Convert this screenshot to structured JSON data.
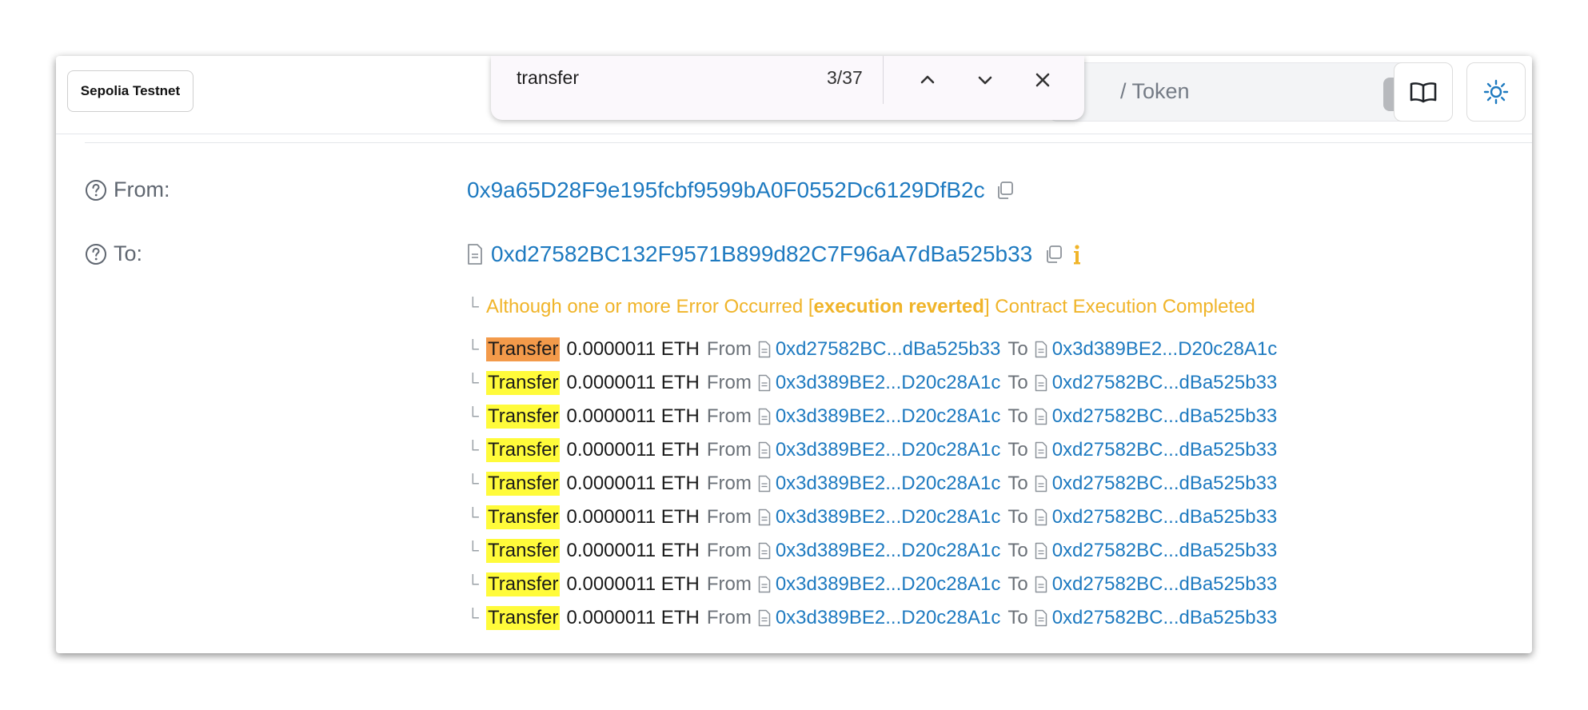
{
  "header": {
    "network": "Sepolia Testnet",
    "search_placeholder": "/ Token",
    "search_shortcut": "/"
  },
  "find_bar": {
    "query": "transfer",
    "count": "3/37"
  },
  "details": {
    "from_label": "From:",
    "from_address": "0x9a65D28F9e195fcbf9599bA0F0552Dc6129DfB2c",
    "to_label": "To:",
    "to_address": "0xd27582BC132F9571B899d82C7F96aA7dBa525b33",
    "note_prefix": "Although one or more Error Occurred [",
    "note_bold": "execution reverted",
    "note_suffix": "] Contract Execution Completed"
  },
  "transfers": [
    {
      "keyword": "Transfer",
      "amount": "0.0000011 ETH",
      "from_word": "From",
      "from": "0xd27582BC...dBa525b33",
      "to_word": "To",
      "to": "0x3d389BE2...D20c28A1c"
    },
    {
      "keyword": "Transfer",
      "amount": "0.0000011 ETH",
      "from_word": "From",
      "from": "0x3d389BE2...D20c28A1c",
      "to_word": "To",
      "to": "0xd27582BC...dBa525b33"
    },
    {
      "keyword": "Transfer",
      "amount": "0.0000011 ETH",
      "from_word": "From",
      "from": "0x3d389BE2...D20c28A1c",
      "to_word": "To",
      "to": "0xd27582BC...dBa525b33"
    },
    {
      "keyword": "Transfer",
      "amount": "0.0000011 ETH",
      "from_word": "From",
      "from": "0x3d389BE2...D20c28A1c",
      "to_word": "To",
      "to": "0xd27582BC...dBa525b33"
    },
    {
      "keyword": "Transfer",
      "amount": "0.0000011 ETH",
      "from_word": "From",
      "from": "0x3d389BE2...D20c28A1c",
      "to_word": "To",
      "to": "0xd27582BC...dBa525b33"
    },
    {
      "keyword": "Transfer",
      "amount": "0.0000011 ETH",
      "from_word": "From",
      "from": "0x3d389BE2...D20c28A1c",
      "to_word": "To",
      "to": "0xd27582BC...dBa525b33"
    },
    {
      "keyword": "Transfer",
      "amount": "0.0000011 ETH",
      "from_word": "From",
      "from": "0x3d389BE2...D20c28A1c",
      "to_word": "To",
      "to": "0xd27582BC...dBa525b33"
    },
    {
      "keyword": "Transfer",
      "amount": "0.0000011 ETH",
      "from_word": "From",
      "from": "0x3d389BE2...D20c28A1c",
      "to_word": "To",
      "to": "0xd27582BC...dBa525b33"
    },
    {
      "keyword": "Transfer",
      "amount": "0.0000011 ETH",
      "from_word": "From",
      "from": "0x3d389BE2...D20c28A1c",
      "to_word": "To",
      "to": "0xd27582BC...dBa525b33"
    }
  ],
  "colors": {
    "link": "#1e7ac0",
    "warning": "#f0b429",
    "find_highlight": "#fffb3a",
    "find_current": "#f39a4a"
  }
}
